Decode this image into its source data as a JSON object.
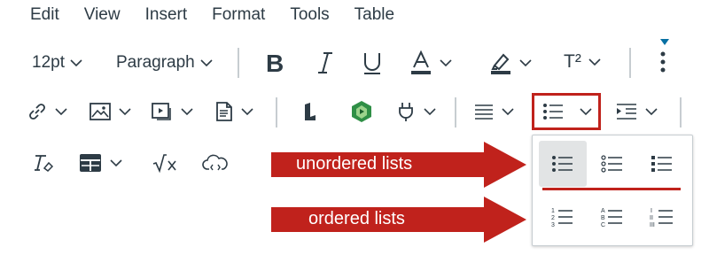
{
  "menubar": {
    "items": [
      "Edit",
      "View",
      "Insert",
      "Format",
      "Tools",
      "Table"
    ]
  },
  "toolbar": {
    "font_size": "12pt",
    "block_format": "Paragraph",
    "superscript_label": "T²"
  },
  "annotations": {
    "unordered": "unordered lists",
    "ordered": "ordered lists"
  },
  "colors": {
    "accent_red": "#c0221c",
    "icon": "#2d3b45",
    "popup_border": "#c7cdd1"
  }
}
